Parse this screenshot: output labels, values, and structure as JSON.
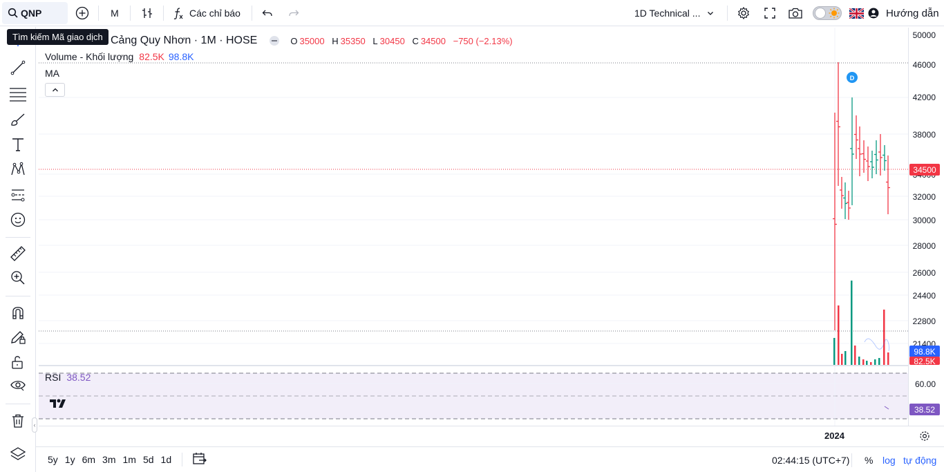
{
  "toolbar": {
    "symbol": "QNP",
    "interval": "M",
    "indicators_label": "Các chỉ báo",
    "layout_name": "1D Technical ...",
    "help_label": "Hướng dẫn"
  },
  "tooltip": {
    "text": "Tìm kiếm Mã giao dịch"
  },
  "legend": {
    "title": "Cảng Quy Nhơn · 1M · HOSE",
    "o_label": "O",
    "o": "35000",
    "h_label": "H",
    "h": "35350",
    "l_label": "L",
    "l": "30450",
    "c_label": "C",
    "c": "34500",
    "change": "−750 (−2.13%)",
    "volume_label": "Volume - Khối lượng",
    "volume_1": "82.5K",
    "volume_2": "98.8K",
    "ma_label": "MA",
    "rsi_label": "RSI",
    "rsi_value": "38.52"
  },
  "price_axis": {
    "ticks": [
      "50000",
      "46000",
      "42000",
      "38000",
      "34000",
      "32000",
      "30000",
      "28000",
      "26000",
      "24400",
      "22800",
      "21400"
    ],
    "last_price": "34500",
    "volume_ma_label": "98.8K",
    "volume_label": "82.5K",
    "rsi_tick": "60.00",
    "rsi_label": "38.52"
  },
  "time_axis": {
    "label": "2024"
  },
  "bottom": {
    "ranges": [
      "5y",
      "1y",
      "6m",
      "3m",
      "1m",
      "5d",
      "1d"
    ],
    "clock": "02:44:15 (UTC+7)",
    "percent": "%",
    "log": "log",
    "auto": "tự động"
  },
  "event_marker": "D",
  "colors": {
    "up": "#089981",
    "down": "#f23645",
    "rsi": "#7e57c2",
    "accent": "#2962ff"
  }
}
